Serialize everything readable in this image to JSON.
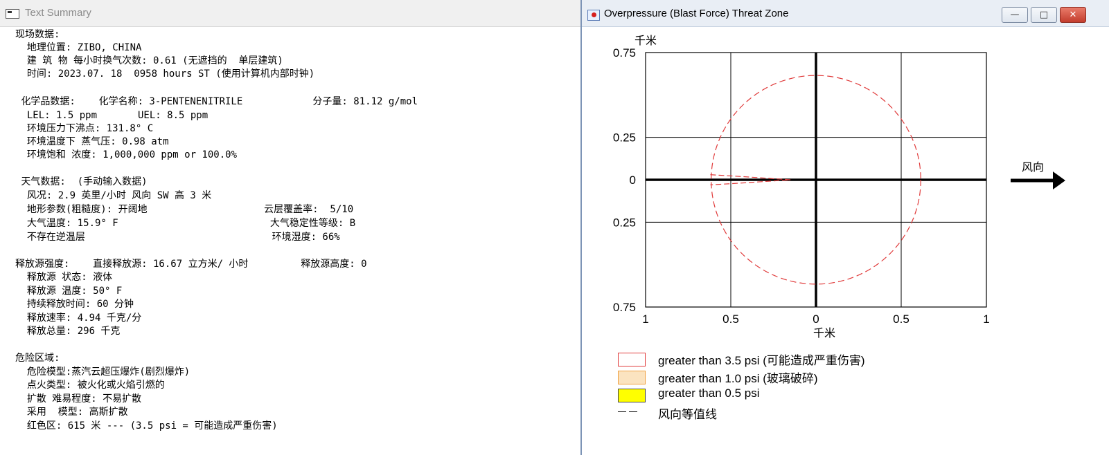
{
  "left_window": {
    "title": "Text Summary",
    "lines": [
      "现场数据:",
      "  地理位置: ZIBO, CHINA",
      "  建 筑 物 每小时换气次数: 0.61 (无遮挡的  单层建筑)",
      "  时间: 2023.07. 18  0958 hours ST (使用计算机内部时钟)",
      "",
      " 化学品数据:    化学名称: 3-PENTENENITRILE            分子量: 81.12 g/mol",
      "  LEL: 1.5 ppm       UEL: 8.5 ppm",
      "  环境压力下沸点: 131.8° C",
      "  环境温度下 蒸气压: 0.98 atm",
      "  环境饱和 浓度: 1,000,000 ppm or 100.0%",
      "",
      " 天气数据:  (手动输入数据)",
      "  风况: 2.9 英里/小时 风向 SW 高 3 米",
      "  地形参数(粗糙度): 开阔地                    云层覆盖率:  5/10",
      "  大气温度: 15.9° F                          大气稳定性等级: B",
      "  不存在逆温层                                环境湿度: 66%",
      "",
      "释放源强度:    直接释放源: 16.67 立方米/ 小时         释放源高度: 0",
      "  释放源 状态: 液体",
      "  释放源 温度: 50° F",
      "  持续释放时间: 60 分钟",
      "  释放速率: 4.94 千克/分",
      "  释放总量: 296 千克",
      "",
      "危险区域:",
      "  危险模型:蒸汽云超压爆炸(剧烈爆炸)",
      "  点火类型: 被火化或火焰引燃的",
      "  扩散 难易程度: 不易扩散",
      "  采用  模型: 高斯扩散",
      "  红色区: 615 米 --- (3.5 psi = 可能造成严重伤害)"
    ]
  },
  "right_window": {
    "title": "Overpressure (Blast Force) Threat Zone",
    "buttons": {
      "minimize": "—",
      "maximize": "□",
      "close": "✕"
    },
    "wind_label": "风向",
    "legend": [
      {
        "label": "greater than 3.5 psi (可能造成严重伤害)",
        "color": "#e03a3a"
      },
      {
        "label": "greater than 1.0 psi (玻璃破碎)",
        "color": "#f0a040"
      },
      {
        "label": "greater than 0.5 psi",
        "color": "#ffff00"
      },
      {
        "label": "风向等值线",
        "color": "#000000"
      }
    ]
  },
  "chart_data": {
    "type": "scatter",
    "ylabel": "千米",
    "xlabel": "千米",
    "x_ticks": [
      "1",
      "0.5",
      "0",
      "0.5",
      "1"
    ],
    "y_ticks": [
      "0.75",
      "0.25",
      "0",
      "0.25",
      "0.75"
    ],
    "xlim": [
      -1,
      1
    ],
    "ylim": [
      -0.75,
      0.75
    ],
    "grid": true,
    "threat_zone": {
      "shape": "circle",
      "center": [
        0,
        0
      ],
      "radius": 0.615,
      "color": "#e03a3a",
      "style": "dashed"
    },
    "confidence_line": {
      "color": "#e03a3a",
      "style": "dashed",
      "points": [
        [
          -0.62,
          0.03
        ],
        [
          -0.45,
          0.02
        ],
        [
          -0.3,
          0.01
        ],
        [
          -0.15,
          0.0
        ],
        [
          -0.3,
          -0.01
        ],
        [
          -0.45,
          -0.02
        ],
        [
          -0.62,
          -0.03
        ]
      ]
    }
  }
}
